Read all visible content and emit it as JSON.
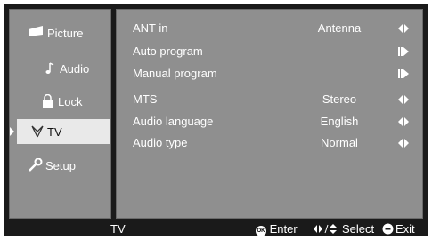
{
  "sidebar": {
    "items": [
      {
        "label": "Picture",
        "icon": "picture-icon"
      },
      {
        "label": "Audio",
        "icon": "music-note-icon"
      },
      {
        "label": "Lock",
        "icon": "lock-icon"
      },
      {
        "label": "TV",
        "icon": "tv-antenna-icon",
        "selected": true
      },
      {
        "label": "Setup",
        "icon": "wrench-icon"
      }
    ]
  },
  "menu": {
    "rows": [
      {
        "name": "ANT in",
        "value": "Antenna",
        "control": "left-right-arrows"
      },
      {
        "name": "Auto program",
        "value": "",
        "control": "enter-arrow"
      },
      {
        "name": "Manual program",
        "value": "",
        "control": "enter-arrow"
      },
      {
        "name": "MTS",
        "value": "Stereo",
        "control": "left-right-arrows"
      },
      {
        "name": "Audio language",
        "value": "English",
        "control": "left-right-arrows"
      },
      {
        "name": "Audio type",
        "value": "Normal",
        "control": "left-right-arrows"
      }
    ]
  },
  "statusbar": {
    "title": "TV",
    "ok_badge": "OK",
    "enter_label": "Enter",
    "select_label": "Select",
    "exit_label": "Exit"
  },
  "colors": {
    "panel": "#8f8f8f",
    "frame": "#1a1a1a",
    "text": "#ffffff",
    "selected_bg": "#e9e9e9"
  }
}
